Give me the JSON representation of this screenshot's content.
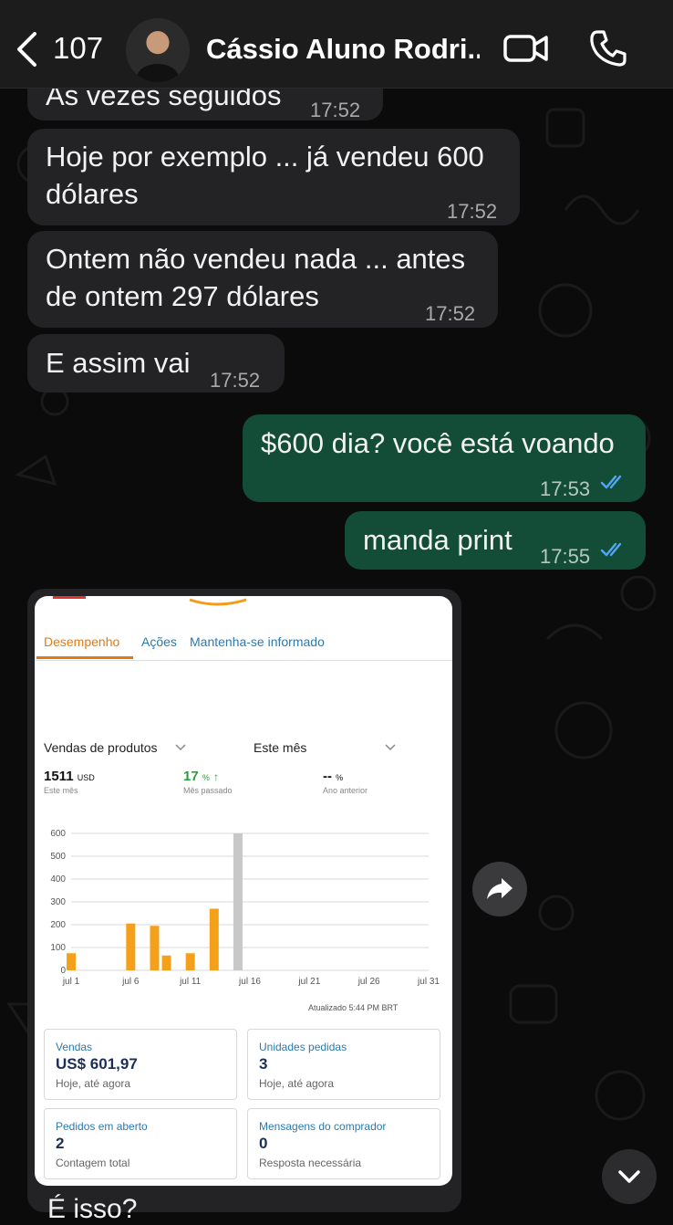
{
  "header": {
    "back_count": "107",
    "contact_name": "Cássio Aluno Rodri..."
  },
  "messages": [
    {
      "text": "Às vezes seguidos",
      "time": "17:52"
    },
    {
      "text_line1": "Hoje por exemplo ... já vendeu 600",
      "text_line2": "dólares",
      "time": "17:52"
    },
    {
      "text_line1": "Ontem não vendeu nada ... antes",
      "text_line2": "de ontem 297 dólares",
      "time": "17:52"
    },
    {
      "text": "E assim vai",
      "time": "17:52"
    },
    {
      "text": "$600 dia? você está voando",
      "time": "17:53"
    },
    {
      "text": "manda print",
      "time": "17:55"
    }
  ],
  "screenshot": {
    "tabs": [
      "Desempenho",
      "Ações",
      "Mantenha-se informado"
    ],
    "metric_selector": "Vendas de produtos",
    "period_selector": "Este mês",
    "metrics": [
      {
        "value": "1511",
        "unit": "USD",
        "label": "Este mês"
      },
      {
        "value": "17",
        "unit": "%",
        "label": "Mês passado"
      },
      {
        "value": "--",
        "unit": "%",
        "label": "Ano anterior"
      }
    ],
    "updated": "Atualizado 5:44 PM BRT",
    "stats": [
      {
        "title": "Vendas",
        "value": "US$ 601,97",
        "sub": "Hoje, até agora"
      },
      {
        "title": "Unidades pedidas",
        "value": "3",
        "sub": "Hoje, até agora"
      },
      {
        "title": "Pedidos em aberto",
        "value": "2",
        "sub": "Contagem total"
      },
      {
        "title": "Mensagens do comprador",
        "value": "0",
        "sub": "Resposta necessária"
      }
    ]
  },
  "chart_data": {
    "type": "bar",
    "x_ticks": [
      "jul 1",
      "jul 6",
      "jul 11",
      "jul 16",
      "jul 21",
      "jul 26",
      "jul 31"
    ],
    "y_ticks": [
      "0",
      "100",
      "200",
      "300",
      "400",
      "500",
      "600"
    ],
    "ylim": [
      0,
      600
    ],
    "days": [
      1,
      6,
      8,
      9,
      11,
      13,
      15
    ],
    "values": [
      75,
      205,
      195,
      65,
      75,
      270,
      600
    ],
    "highlight_day": 15,
    "colors": {
      "bar": "#f5a01a",
      "today": "#c8c8c8",
      "grid": "#d9d9d9"
    }
  },
  "bottom_text": "É isso?",
  "colors": {
    "incoming": "#232325",
    "outgoing": "#134d37",
    "read_ticks": "#53a6f5"
  }
}
